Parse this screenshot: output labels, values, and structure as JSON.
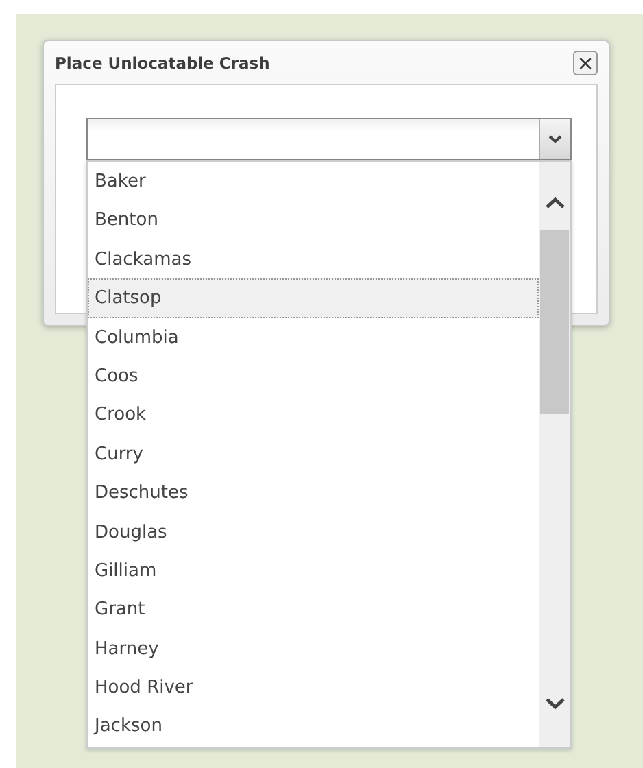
{
  "dialog": {
    "title": "Place Unlocatable Crash",
    "close": "×"
  },
  "options": [
    {
      "label": "Baker",
      "selected": false
    },
    {
      "label": "Benton",
      "selected": false
    },
    {
      "label": "Clackamas",
      "selected": false
    },
    {
      "label": "Clatsop",
      "selected": true
    },
    {
      "label": "Columbia",
      "selected": false
    },
    {
      "label": "Coos",
      "selected": false
    },
    {
      "label": "Crook",
      "selected": false
    },
    {
      "label": "Curry",
      "selected": false
    },
    {
      "label": "Deschutes",
      "selected": false
    },
    {
      "label": "Douglas",
      "selected": false
    },
    {
      "label": "Gilliam",
      "selected": false
    },
    {
      "label": "Grant",
      "selected": false
    },
    {
      "label": "Harney",
      "selected": false
    },
    {
      "label": "Hood River",
      "selected": false
    },
    {
      "label": "Jackson",
      "selected": false
    }
  ]
}
